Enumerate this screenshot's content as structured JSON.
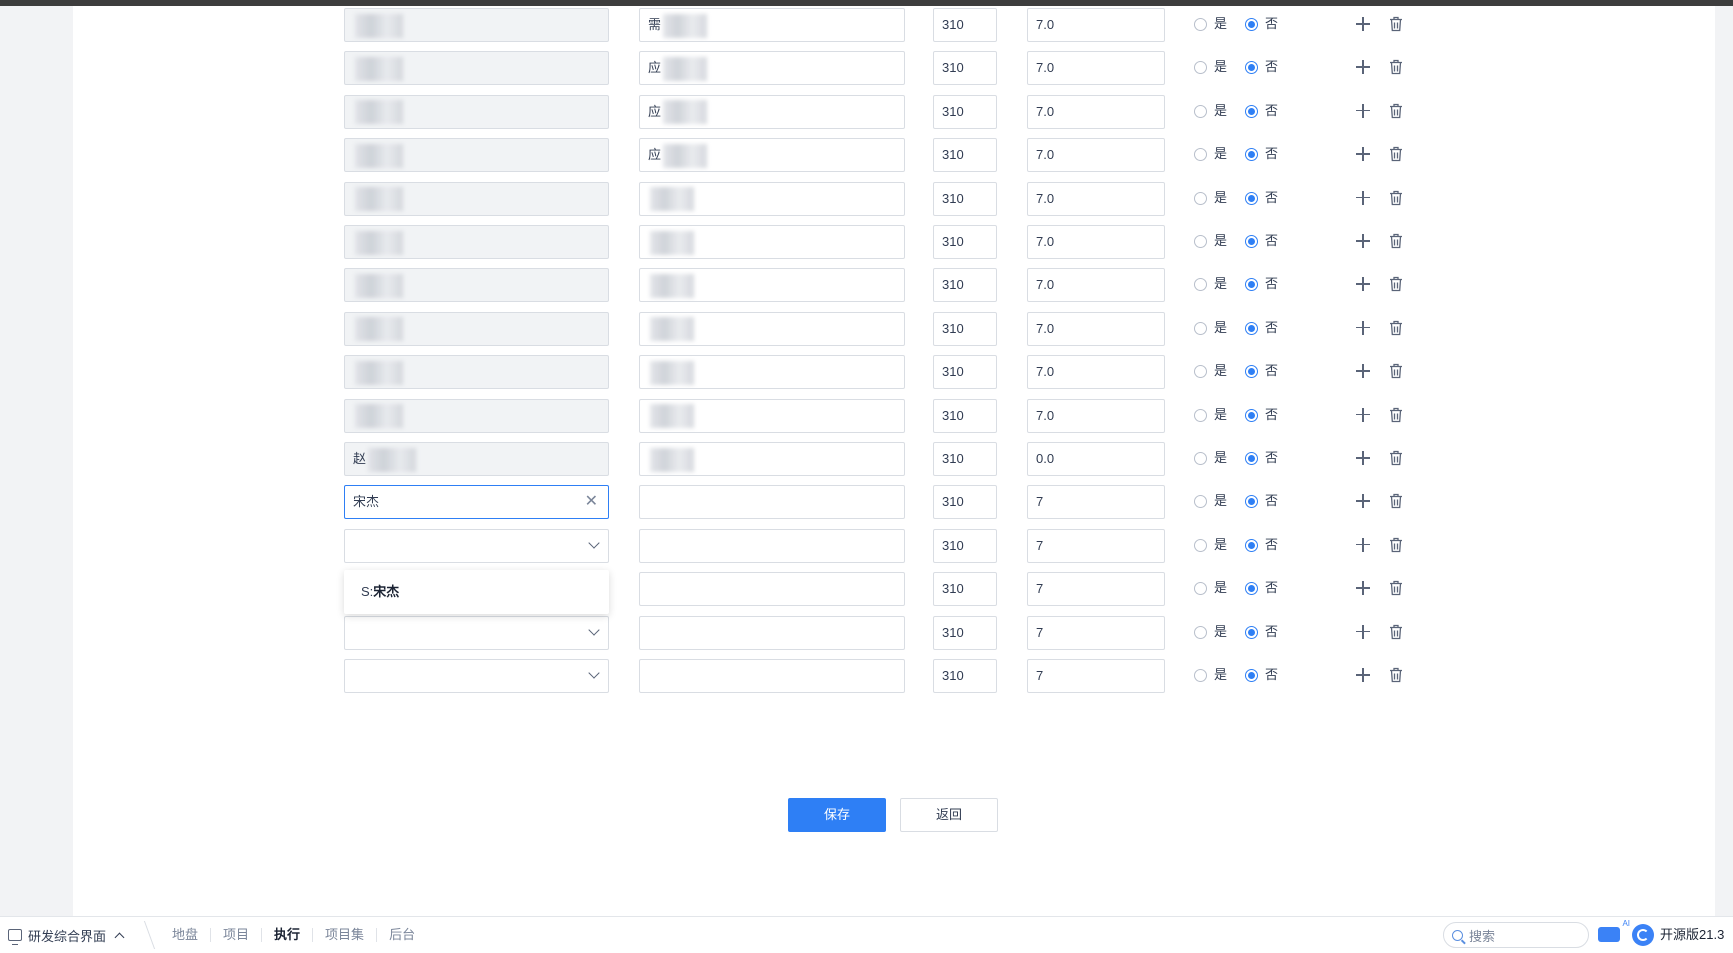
{
  "form": {
    "radio_yes": "是",
    "radio_no": "否",
    "rows": [
      {
        "user": "",
        "user_state": "readonly",
        "task": "需",
        "hours": "310",
        "days": "7.0",
        "selected": "no"
      },
      {
        "user": "",
        "user_state": "readonly",
        "task": "应",
        "hours": "310",
        "days": "7.0",
        "selected": "no"
      },
      {
        "user": "",
        "user_state": "readonly",
        "task": "应",
        "hours": "310",
        "days": "7.0",
        "selected": "no"
      },
      {
        "user": "",
        "user_state": "readonly",
        "task": "应",
        "hours": "310",
        "days": "7.0",
        "selected": "no"
      },
      {
        "user": "",
        "user_state": "readonly",
        "task": "",
        "hours": "310",
        "days": "7.0",
        "selected": "no"
      },
      {
        "user": "",
        "user_state": "readonly",
        "task": "",
        "hours": "310",
        "days": "7.0",
        "selected": "no"
      },
      {
        "user": "",
        "user_state": "readonly",
        "task": "",
        "hours": "310",
        "days": "7.0",
        "selected": "no"
      },
      {
        "user": "",
        "user_state": "readonly",
        "task": "",
        "hours": "310",
        "days": "7.0",
        "selected": "no"
      },
      {
        "user": "",
        "user_state": "readonly",
        "task": "",
        "hours": "310",
        "days": "7.0",
        "selected": "no"
      },
      {
        "user": "",
        "user_state": "readonly",
        "task": "",
        "hours": "310",
        "days": "7.0",
        "selected": "no"
      },
      {
        "user": "赵",
        "user_state": "readonly",
        "task": "",
        "hours": "310",
        "days": "0.0",
        "selected": "no"
      },
      {
        "user": "宋杰",
        "user_state": "focus",
        "task": "",
        "hours": "310",
        "days": "7",
        "selected": "no"
      },
      {
        "user": "",
        "user_state": "select",
        "task": "",
        "hours": "310",
        "days": "7",
        "selected": "no"
      },
      {
        "user": "",
        "user_state": "select",
        "task": "",
        "hours": "310",
        "days": "7",
        "selected": "no"
      },
      {
        "user": "",
        "user_state": "select",
        "task": "",
        "hours": "310",
        "days": "7",
        "selected": "no"
      },
      {
        "user": "",
        "user_state": "select",
        "task": "",
        "hours": "310",
        "days": "7",
        "selected": "no"
      }
    ],
    "dropdown": {
      "prefix": "S:",
      "match": "宋杰"
    },
    "clear_symbol": "✕",
    "save_label": "保存",
    "back_label": "返回"
  },
  "bottombar": {
    "app_name": "研发综合界面",
    "nav": [
      {
        "label": "地盘",
        "active": false
      },
      {
        "label": "项目",
        "active": false
      },
      {
        "label": "执行",
        "active": true
      },
      {
        "label": "项目集",
        "active": false
      },
      {
        "label": "后台",
        "active": false
      }
    ],
    "search_placeholder": "搜索",
    "version": "开源版21.3"
  },
  "colors": {
    "accent": "#2e7ff5",
    "border": "#d9dde3",
    "readonly_bg": "#f1f3f5"
  }
}
